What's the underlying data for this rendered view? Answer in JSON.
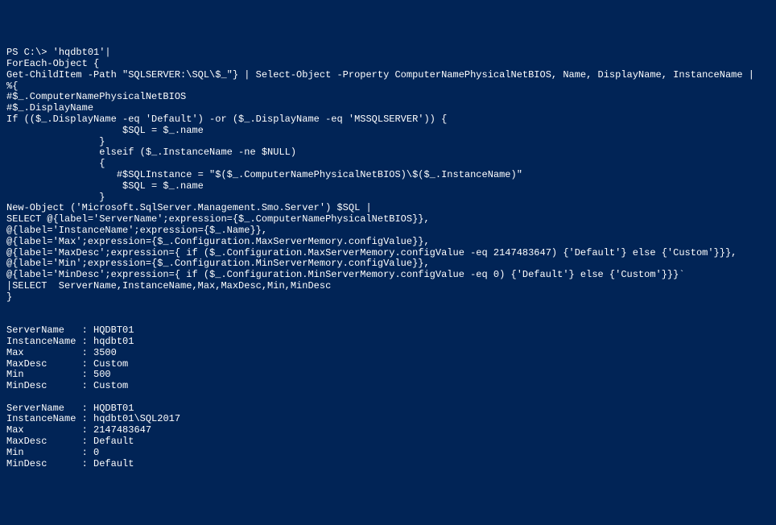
{
  "terminal": {
    "prompt": "PS C:\\>",
    "command": "'hqdbt01'|",
    "script_lines": [
      "ForEach-Object {",
      "Get-ChildItem -Path \"SQLSERVER:\\SQL\\$_\"} | Select-Object -Property ComputerNamePhysicalNetBIOS, Name, DisplayName, InstanceName |",
      "%{",
      "#$_.ComputerNamePhysicalNetBIOS",
      "#$_.DisplayName",
      "If (($_.DisplayName -eq 'Default') -or ($_.DisplayName -eq 'MSSQLSERVER')) {",
      "                    $SQL = $_.name",
      "                }",
      "                elseif ($_.InstanceName -ne $NULL)",
      "                {",
      "                   #$SQLInstance = \"$($_.ComputerNamePhysicalNetBIOS)\\$($_.InstanceName)\"",
      "                    $SQL = $_.name",
      "                }",
      "New-Object ('Microsoft.SqlServer.Management.Smo.Server') $SQL |",
      "SELECT @{label='ServerName';expression={$_.ComputerNamePhysicalNetBIOS}},",
      "@{label='InstanceName';expression={$_.Name}},",
      "@{label='Max';expression={$_.Configuration.MaxServerMemory.configValue}},",
      "@{label='MaxDesc';expression={ if ($_.Configuration.MaxServerMemory.configValue -eq 2147483647) {'Default'} else {'Custom'}}},",
      "@{label='Min';expression={$_.Configuration.MinServerMemory.configValue}},",
      "@{label='MinDesc';expression={ if ($_.Configuration.MinServerMemory.configValue -eq 0) {'Default'} else {'Custom'}}}`",
      "|SELECT  ServerName,InstanceName,Max,MaxDesc,Min,MinDesc",
      "}"
    ],
    "output": {
      "records": [
        {
          "ServerName": "HQDBT01",
          "InstanceName": "hqdbt01",
          "Max": "3500",
          "MaxDesc": "Custom",
          "Min": "500",
          "MinDesc": "Custom"
        },
        {
          "ServerName": "HQDBT01",
          "InstanceName": "hqdbt01\\SQL2017",
          "Max": "2147483647",
          "MaxDesc": "Default",
          "Min": "0",
          "MinDesc": "Default"
        }
      ],
      "labels": {
        "ServerName": "ServerName",
        "InstanceName": "InstanceName",
        "Max": "Max",
        "MaxDesc": "MaxDesc",
        "Min": "Min",
        "MinDesc": "MinDesc"
      }
    }
  }
}
